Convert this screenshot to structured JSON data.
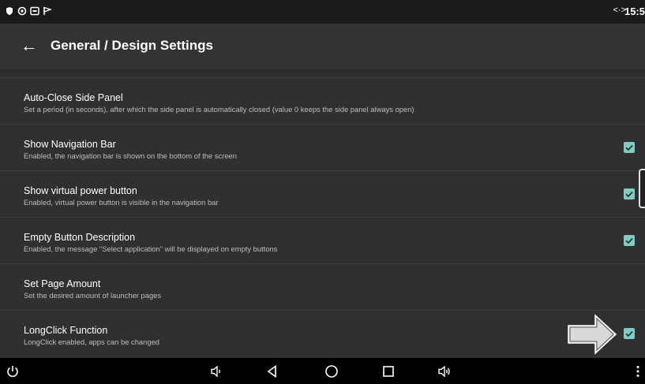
{
  "status_bar": {
    "icons": [
      "shield-icon",
      "eye-icon",
      "screen-icon",
      "flag-icon"
    ],
    "code_icon": "<·>",
    "time": "15:5"
  },
  "header": {
    "back_icon": "←",
    "title": "General / Design Settings"
  },
  "settings": [
    {
      "title": "Auto-Close Side Panel",
      "subtitle": "Set a period (in seconds), after which the side panel is automatically closed (value 0 keeps the side panel always open)",
      "checkbox": null
    },
    {
      "title": "Show Navigation Bar",
      "subtitle": "Enabled, the navigation bar is shown on the bottom of the screen",
      "checkbox": true
    },
    {
      "title": "Show virtual power button",
      "subtitle": "Enabled, virtual power button is visible in the navigation bar",
      "checkbox": true
    },
    {
      "title": "Empty Button Description",
      "subtitle": "Enabled, the message \"Select application\" will be displayed on empty buttons",
      "checkbox": true
    },
    {
      "title": "Set Page Amount",
      "subtitle": "Set the desired amount of launcher pages",
      "checkbox": null
    },
    {
      "title": "LongClick Function",
      "subtitle": "LongClick enabled, apps can be changed",
      "checkbox": true
    }
  ],
  "nav_bar": {
    "buttons": [
      "power-icon",
      "volume-down-icon",
      "back-icon",
      "home-icon",
      "recents-icon",
      "volume-up-icon",
      "menu-icon"
    ]
  },
  "colors": {
    "background": "#303030",
    "appbar": "#333333",
    "statusbar": "#1b1b1b",
    "checkbox": "#80cbc4",
    "navbar": "#000000"
  }
}
